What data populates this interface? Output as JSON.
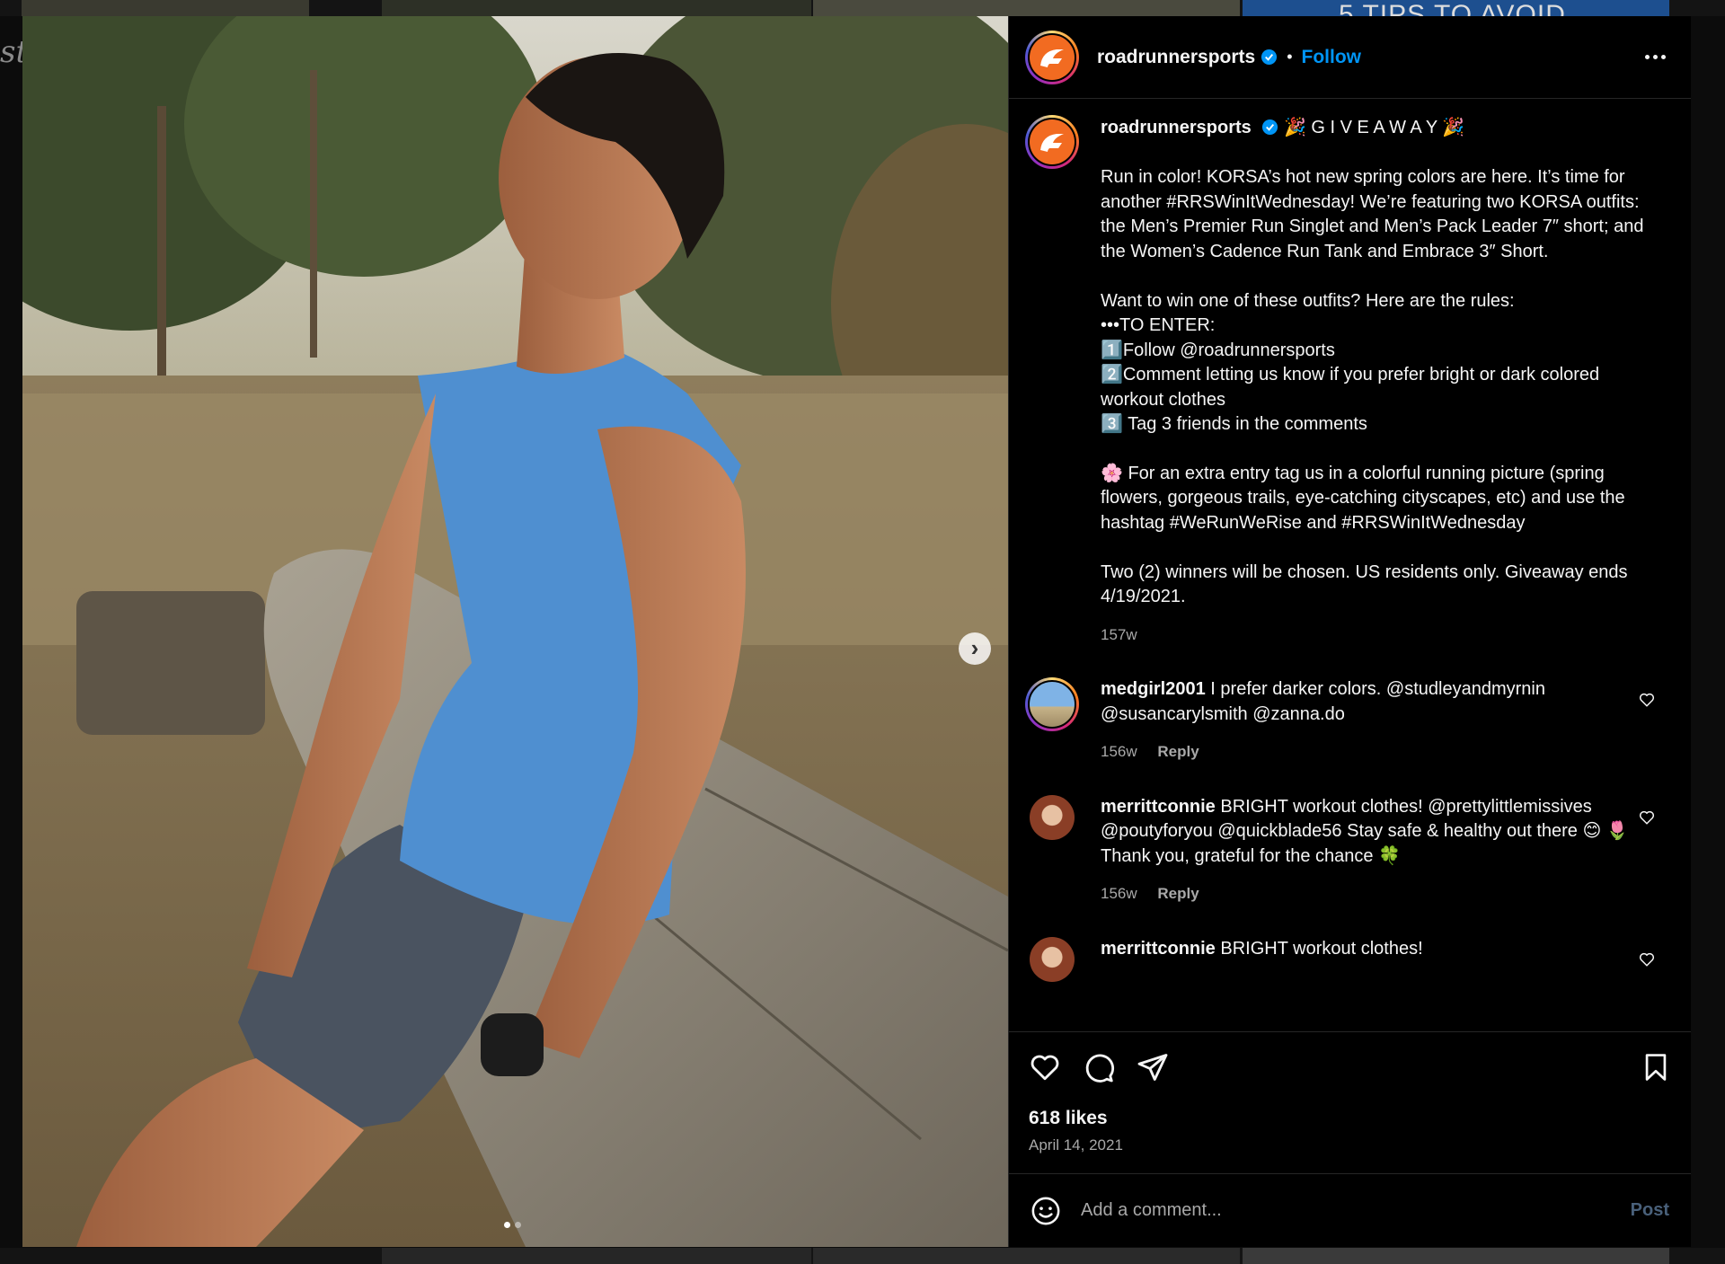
{
  "background": {
    "left_partial_text": "st",
    "top_right_partial_title": "5 TIPS TO AVOID"
  },
  "post": {
    "username": "roadrunnersports",
    "follow_label": "Follow",
    "separator": "•",
    "caption_lines": [
      "🎉 G I V E A W A Y 🎉",
      "⠀⠀⠀⠀⠀⠀⠀⠀⠀⠀",
      "Run in color! KORSA’s hot new spring colors are here. It’s time for another #RRSWinItWednesday! We’re featuring two KORSA outfits: the Men’s Premier Run Singlet and Men’s Pack Leader 7″ short; and the Women’s Cadence Run Tank and Embrace 3″ Short.",
      "⠀⠀⠀⠀⠀⠀⠀⠀⠀⠀",
      "Want to win one of these outfits? Here are the rules:",
      "•••TO ENTER:",
      "1️⃣Follow @roadrunnersports",
      "2️⃣Comment letting us know if you prefer bright or dark colored workout clothes",
      "3️⃣ Tag 3 friends in the comments",
      "",
      "🌸 For an extra entry tag us in a colorful running picture (spring flowers, gorgeous trails, eye-catching cityscapes, etc) and use the hashtag #WeRunWeRise and #RRSWinItWednesday",
      "⠀⠀⠀⠀⠀⠀⠀⠀⠀⠀",
      "Two (2) winners will be chosen. US residents only. Giveaway ends 4/19/2021."
    ],
    "caption_age": "157w",
    "likes": "618 likes",
    "date": "April 14, 2021",
    "carousel": {
      "current": 1,
      "total": 2
    }
  },
  "comments": [
    {
      "username": "medgirl2001",
      "text": "I prefer darker colors. @studleyandmyrnin @susancarylsmith @zanna.do",
      "age": "156w",
      "reply_label": "Reply"
    },
    {
      "username": "merrittconnie",
      "text": "BRIGHT workout clothes! @prettylittlemissives @poutyforyou @quickblade56 Stay safe & healthy out there 😊 🌷Thank you, grateful for the chance 🍀",
      "age": "156w",
      "reply_label": "Reply"
    },
    {
      "username": "merrittconnie",
      "text": "BRIGHT workout clothes!"
    }
  ],
  "add_comment": {
    "placeholder": "Add a comment...",
    "post_label": "Post"
  },
  "icons": [
    "heart-icon",
    "comment-icon",
    "share-icon",
    "bookmark-icon",
    "emoji-icon",
    "more-icon",
    "verified-icon",
    "chevron-right-icon"
  ],
  "colors": {
    "accent": "#0095f6",
    "brand_orange": "#f26b21",
    "muted": "#a8a8a8"
  }
}
